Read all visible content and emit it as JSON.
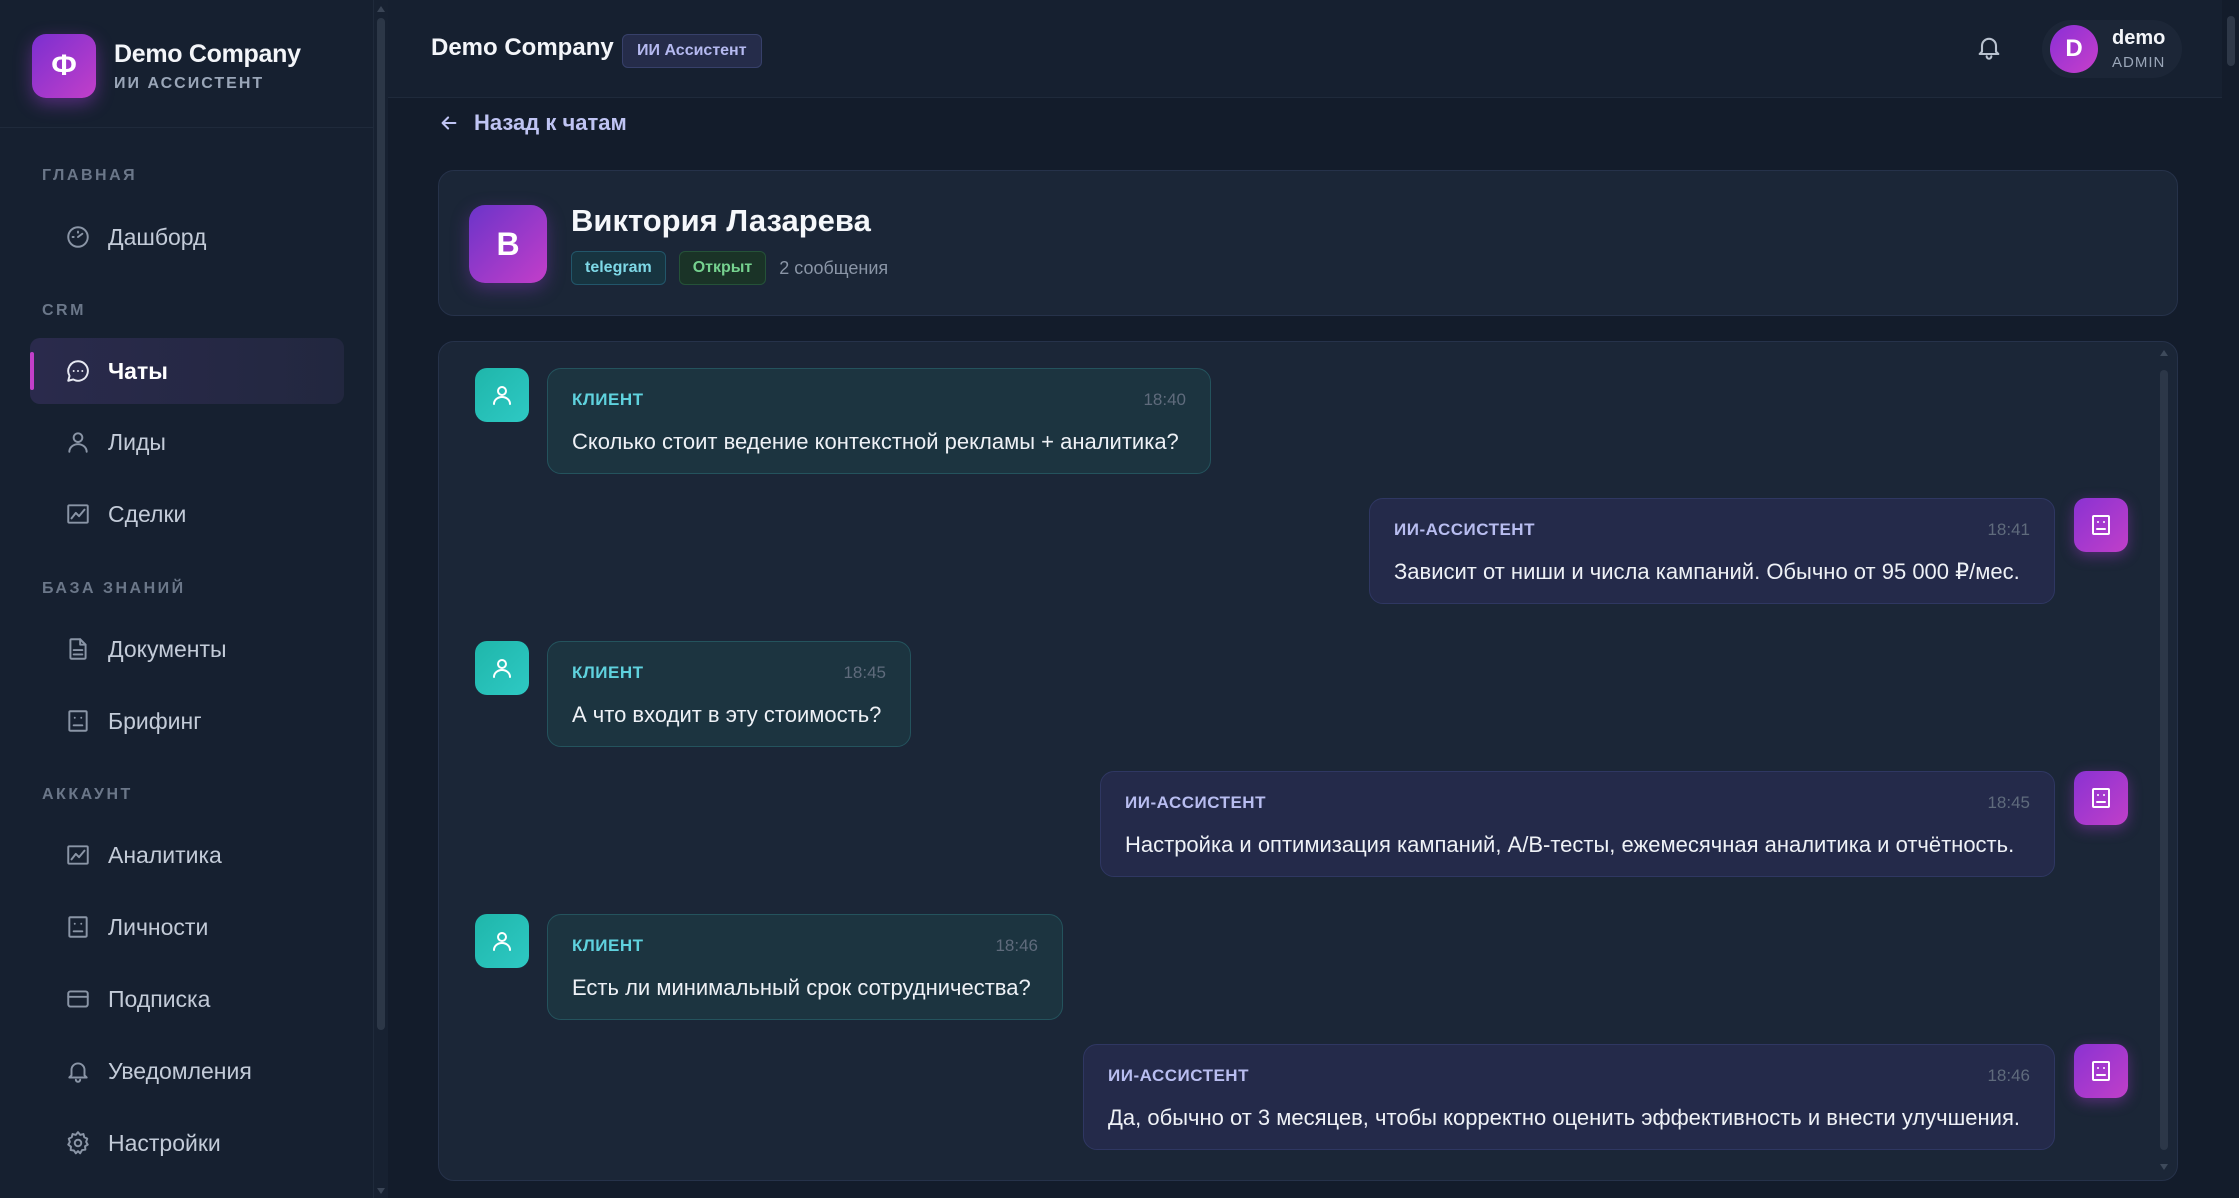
{
  "sidebar": {
    "brand": {
      "logo_letter": "Ф",
      "name": "Demo Company",
      "subtitle": "ИИ АССИСТЕНТ"
    },
    "sections": [
      {
        "title": "ГЛАВНАЯ",
        "items": [
          {
            "label": "Дашборд",
            "icon": "dashboard-icon"
          }
        ]
      },
      {
        "title": "CRM",
        "items": [
          {
            "label": "Чаты",
            "icon": "chat-icon",
            "active": true
          },
          {
            "label": "Лиды",
            "icon": "user-icon"
          },
          {
            "label": "Сделки",
            "icon": "chart-icon"
          }
        ]
      },
      {
        "title": "БАЗА ЗНАНИЙ",
        "items": [
          {
            "label": "Документы",
            "icon": "document-icon"
          },
          {
            "label": "Брифинг",
            "icon": "briefing-icon"
          }
        ]
      },
      {
        "title": "АККАУНТ",
        "items": [
          {
            "label": "Аналитика",
            "icon": "analytics-icon"
          },
          {
            "label": "Личности",
            "icon": "persona-icon"
          },
          {
            "label": "Подписка",
            "icon": "card-icon"
          },
          {
            "label": "Уведомления",
            "icon": "bell-icon"
          },
          {
            "label": "Настройки",
            "icon": "gear-icon"
          }
        ]
      }
    ]
  },
  "header": {
    "title": "Demo Company",
    "badge": "ИИ Ассистент",
    "user": {
      "avatar_letter": "D",
      "name": "demo",
      "role": "ADMIN"
    }
  },
  "content": {
    "back_label": "Назад к чатам",
    "contact": {
      "avatar_letter": "В",
      "name": "Виктория Лазарева",
      "channel": "telegram",
      "status": "Открыт",
      "message_count": "2 сообщения"
    },
    "messages": [
      {
        "from": "client",
        "author": "КЛИЕНТ",
        "time": "18:40",
        "text": "Сколько стоит ведение контекстной рекламы + аналитика?"
      },
      {
        "from": "bot",
        "author": "ИИ-АССИСТЕНТ",
        "time": "18:41",
        "text": "Зависит от ниши и числа кампаний. Обычно от 95 000 ₽/мес."
      },
      {
        "from": "client",
        "author": "КЛИЕНТ",
        "time": "18:45",
        "text": "А что входит в эту стоимость?"
      },
      {
        "from": "bot",
        "author": "ИИ-АССИСТЕНТ",
        "time": "18:45",
        "text": "Настройка и оптимизация кампаний, A/B-тесты, ежемесячная аналитика и отчётность."
      },
      {
        "from": "client",
        "author": "КЛИЕНТ",
        "time": "18:46",
        "text": "Есть ли минимальный срок сотрудничества?"
      },
      {
        "from": "bot",
        "author": "ИИ-АССИСТЕНТ",
        "time": "18:46",
        "text": "Да, обычно от 3 месяцев, чтобы корректно оценить эффективность и внести улучшения."
      }
    ]
  },
  "colors": {
    "accent": "#c23fc9",
    "client_accent": "#2ec9c4",
    "background": "#131c2b",
    "panel": "#1b2637"
  }
}
